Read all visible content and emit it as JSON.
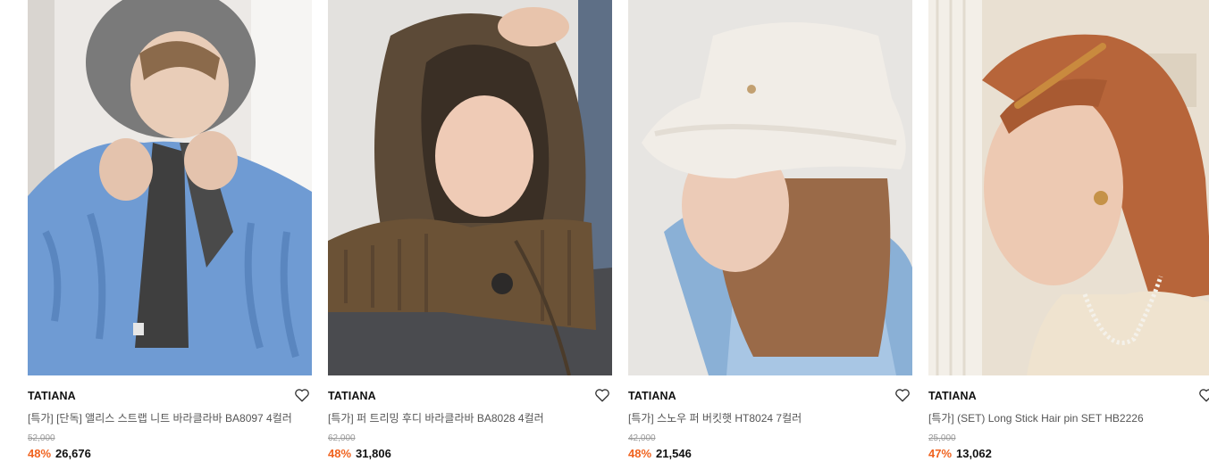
{
  "products": [
    {
      "brand": "TATIANA",
      "title": "[특가] [단독] 앨리스 스트랩 니트 바라클라바 BA8097 4컬러",
      "original_price": "52,000",
      "discount_rate": "48%",
      "sale_price": "26,676",
      "wishlist_icon": "heart-outline-icon"
    },
    {
      "brand": "TATIANA",
      "title": "[특가] 퍼 트리밍 후디 바라클라바 BA8028 4컬러",
      "original_price": "62,000",
      "discount_rate": "48%",
      "sale_price": "31,806",
      "wishlist_icon": "heart-outline-icon"
    },
    {
      "brand": "TATIANA",
      "title": "[특가] 스노우 퍼 버킷햇 HT8024 7컬러",
      "original_price": "42,000",
      "discount_rate": "48%",
      "sale_price": "21,546",
      "wishlist_icon": "heart-outline-icon"
    },
    {
      "brand": "TATIANA",
      "title": "[특가] (SET) Long Stick Hair pin SET HB2226",
      "original_price": "25,000",
      "discount_rate": "47%",
      "sale_price": "13,062",
      "wishlist_icon": "heart-outline-icon"
    }
  ],
  "colors": {
    "discount": "#f0631f",
    "brand_text": "#111111",
    "title_text": "#555555",
    "strike_text": "#9a9a9a"
  }
}
